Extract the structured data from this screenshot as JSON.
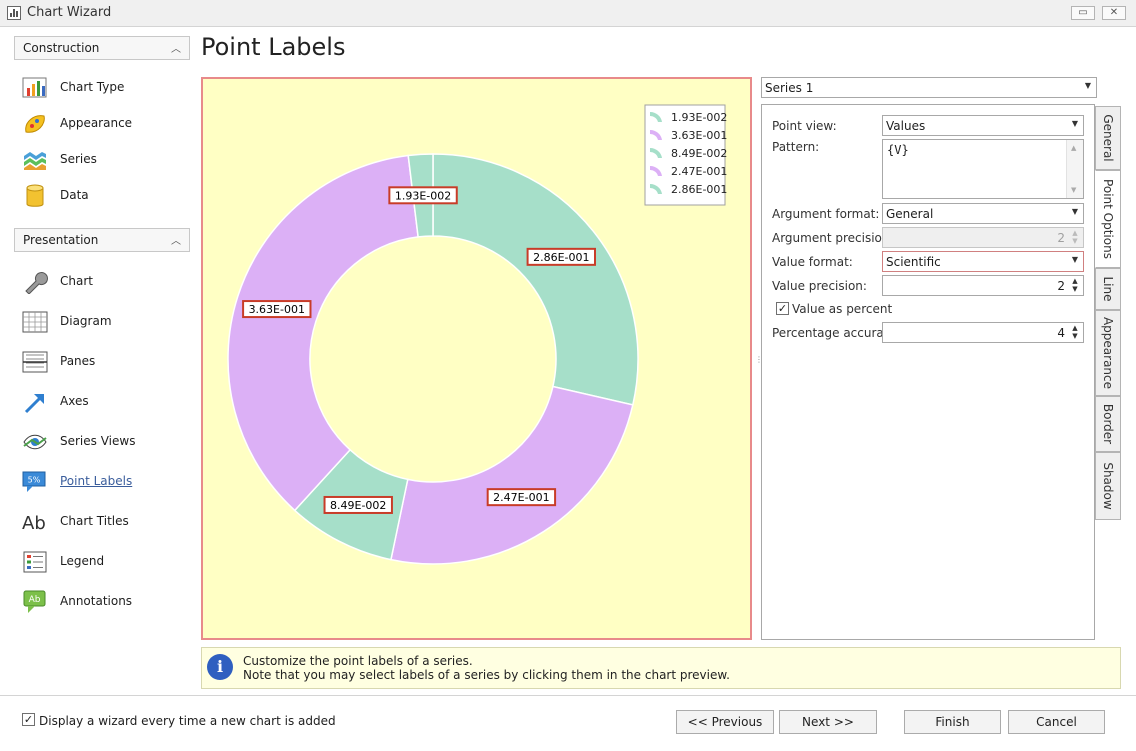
{
  "window": {
    "title": "Chart Wizard",
    "restore_glyph": "▭",
    "close_glyph": "✕"
  },
  "sidebar": {
    "groups": [
      {
        "label": "Construction",
        "items": [
          {
            "label": "Chart Type",
            "icon": "chart-type-icon"
          },
          {
            "label": "Appearance",
            "icon": "appearance-icon"
          },
          {
            "label": "Series",
            "icon": "series-icon"
          },
          {
            "label": "Data",
            "icon": "data-icon"
          }
        ]
      },
      {
        "label": "Presentation",
        "items": [
          {
            "label": "Chart",
            "icon": "chart-wrench-icon"
          },
          {
            "label": "Diagram",
            "icon": "diagram-icon"
          },
          {
            "label": "Panes",
            "icon": "panes-icon"
          },
          {
            "label": "Axes",
            "icon": "axes-icon"
          },
          {
            "label": "Series Views",
            "icon": "series-views-icon"
          },
          {
            "label": "Point Labels",
            "icon": "point-labels-icon",
            "active": true
          },
          {
            "label": "Chart Titles",
            "icon": "chart-titles-icon"
          },
          {
            "label": "Legend",
            "icon": "legend-icon"
          },
          {
            "label": "Annotations",
            "icon": "annotations-icon"
          }
        ]
      }
    ],
    "point_labels_icon_text": "5%",
    "chart_titles_icon_text": "Ab",
    "annotations_icon_text": "Ab"
  },
  "page_title": "Point Labels",
  "chart_data": {
    "type": "doughnut",
    "slices": [
      {
        "label": "2.86E-001",
        "value": 0.286,
        "color": "#a6dfc9"
      },
      {
        "label": "2.47E-001",
        "value": 0.247,
        "color": "#dcb0f6"
      },
      {
        "label": "8.49E-002",
        "value": 0.0849,
        "color": "#a6dfc9"
      },
      {
        "label": "3.63E-001",
        "value": 0.363,
        "color": "#dcb0f6"
      },
      {
        "label": "1.93E-002",
        "value": 0.0193,
        "color": "#a6dfc9"
      }
    ],
    "legend": [
      {
        "label": "1.93E-002",
        "color": "#a6dfc9"
      },
      {
        "label": "3.63E-001",
        "color": "#dcb0f6"
      },
      {
        "label": "8.49E-002",
        "color": "#a6dfc9"
      },
      {
        "label": "2.47E-001",
        "color": "#dcb0f6"
      },
      {
        "label": "2.86E-001",
        "color": "#a6dfc9"
      }
    ],
    "legend_position": "top-right",
    "background": "#ffffc4",
    "label_border_color": "#c83c28"
  },
  "series_select": {
    "value": "Series 1"
  },
  "point_options": {
    "point_view": {
      "label": "Point view:",
      "value": "Values"
    },
    "pattern": {
      "label": "Pattern:",
      "value": "{V}"
    },
    "argument_format": {
      "label": "Argument format:",
      "value": "General"
    },
    "argument_precision": {
      "label": "Argument precision:",
      "value": "2"
    },
    "value_format": {
      "label": "Value format:",
      "value": "Scientific"
    },
    "value_precision": {
      "label": "Value precision:",
      "value": "2"
    },
    "value_as_percent": {
      "label": "Value as percent",
      "checked": true
    },
    "percentage_accuracy": {
      "label": "Percentage accuracy",
      "value": "4"
    }
  },
  "tabs": [
    {
      "label": "General"
    },
    {
      "label": "Point Options",
      "active": true
    },
    {
      "label": "Line"
    },
    {
      "label": "Appearance"
    },
    {
      "label": "Border"
    },
    {
      "label": "Shadow"
    }
  ],
  "info": {
    "line1": "Customize the point labels of a series.",
    "line2": "Note that you may select labels of a series by clicking them in the chart preview."
  },
  "footer": {
    "wizard_checkbox_label": "Display a wizard every time a new chart is added",
    "wizard_checked": true,
    "previous": "<< Previous",
    "next": "Next >>",
    "finish": "Finish",
    "cancel": "Cancel"
  },
  "glyphs": {
    "dropdown": "▼",
    "spin_up": "▲",
    "spin_down": "▼",
    "check": "✓",
    "chevron_up": "︿",
    "info": "i",
    "splitter": "⋮"
  }
}
